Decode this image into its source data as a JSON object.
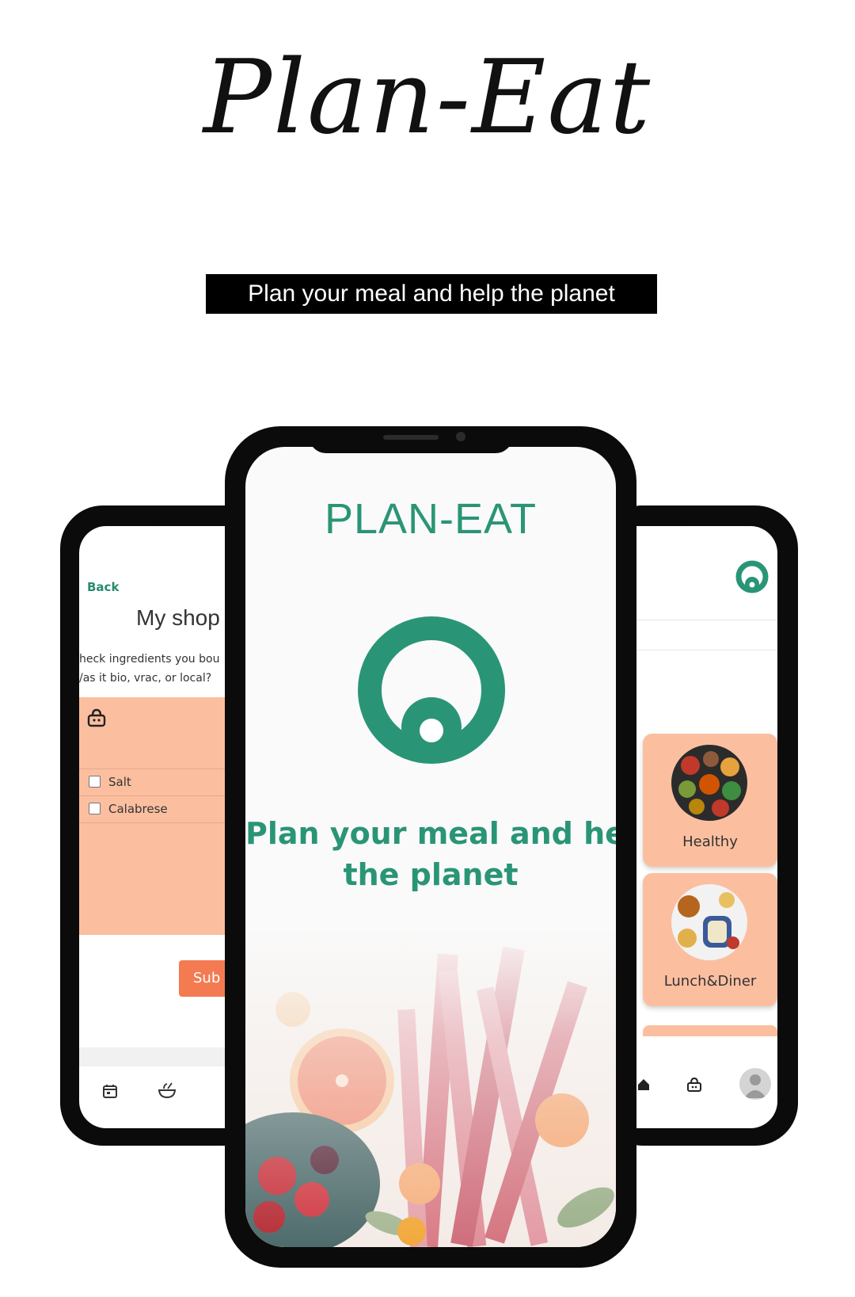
{
  "header": {
    "script_title": "Plan-Eat",
    "tagline": "Plan your meal and help the planet"
  },
  "left_screen": {
    "back_label": "Back",
    "title": "My shop",
    "instruction_1": "heck ingredients you bou",
    "instruction_2": "/as it bio, vrac, or local?",
    "items": [
      "Salt",
      "Calabrese"
    ],
    "submit_label": "Sub",
    "icons": [
      "basket-icon",
      "calendar-icon",
      "bowl-icon"
    ]
  },
  "center_screen": {
    "brand": "PLAN-EAT",
    "tagline_line1": "Plan your meal and hel",
    "tagline_line2": "the planet"
  },
  "right_screen": {
    "categories": [
      "Healthy",
      "Lunch&Diner"
    ],
    "icons": [
      "logo-icon",
      "home-icon",
      "basket-icon",
      "avatar-icon"
    ]
  },
  "colors": {
    "brand_green": "#2a9576",
    "peach": "#fbbfa0",
    "orange_button": "#f47a52"
  }
}
